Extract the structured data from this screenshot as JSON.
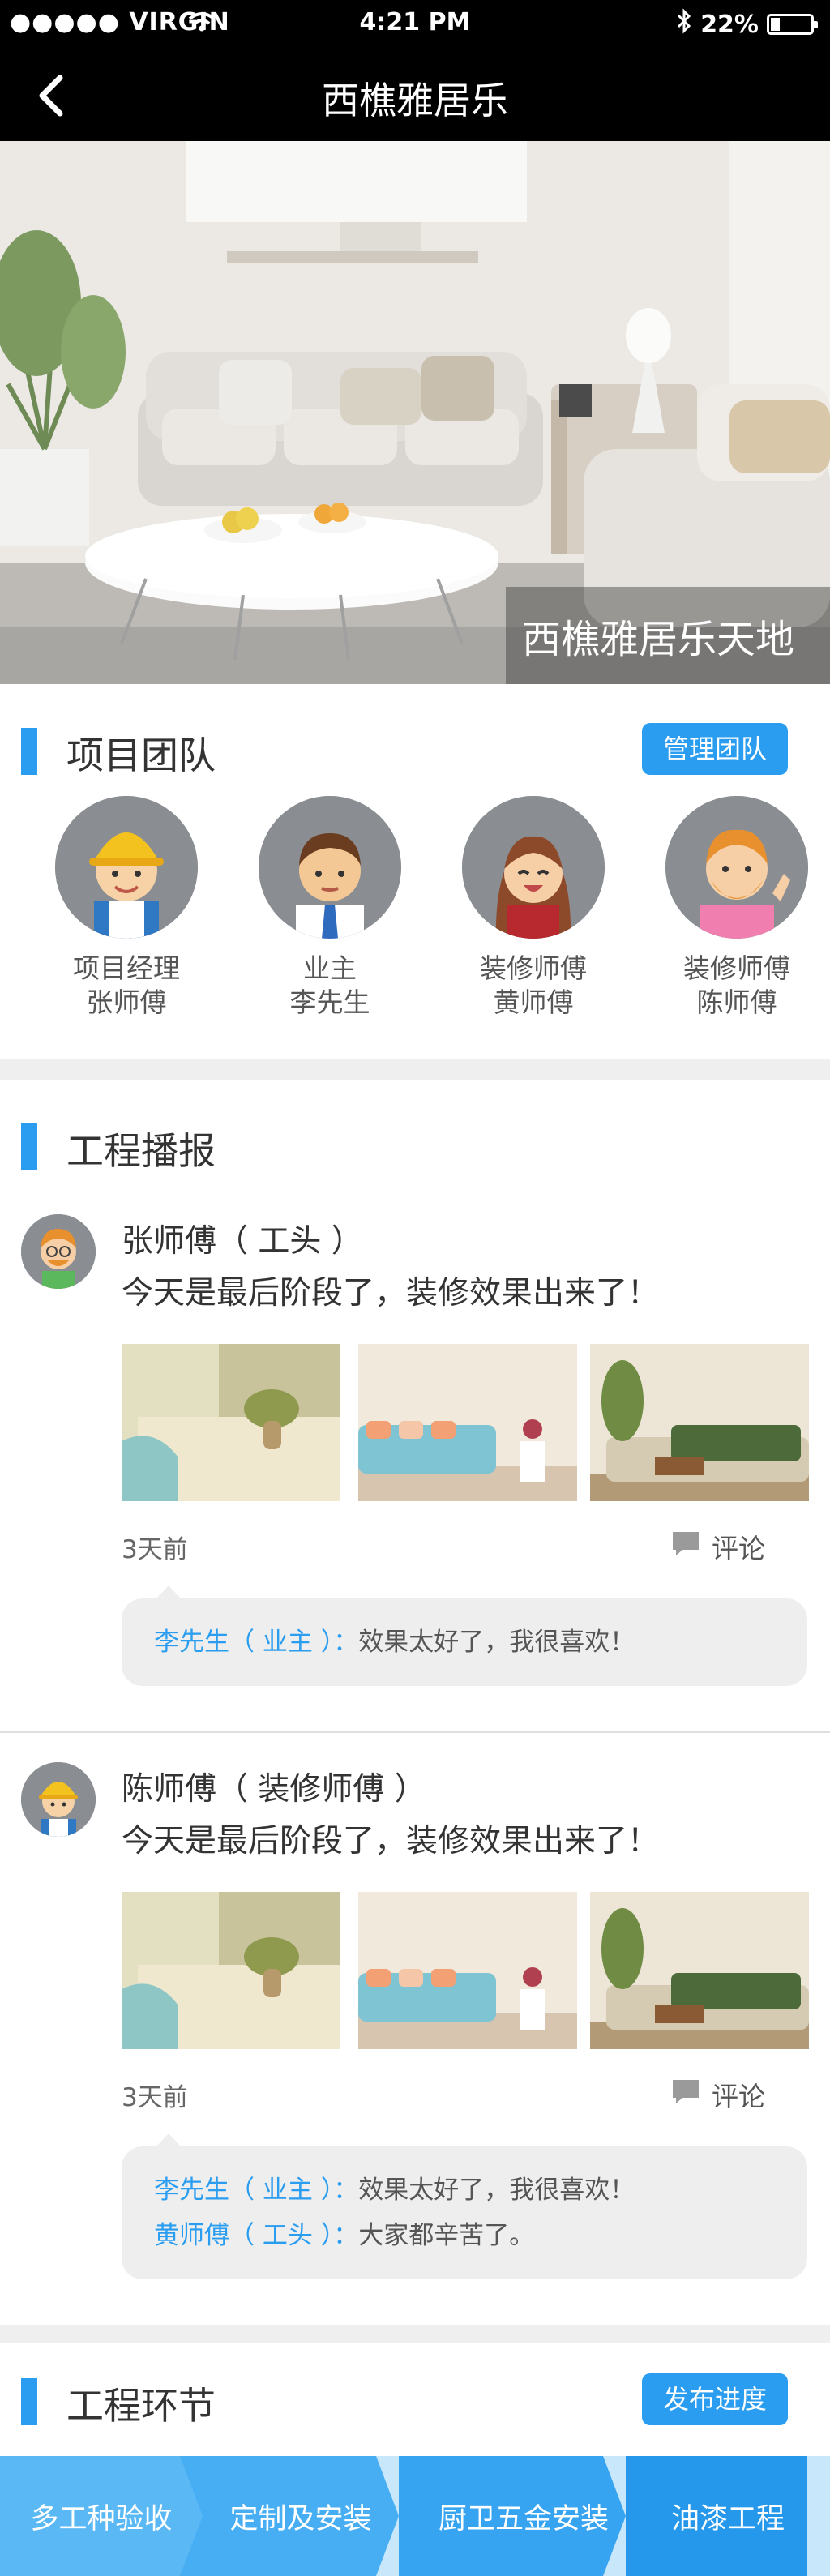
{
  "status_bar": {
    "carrier": "●●●●● VIRGIN",
    "time": "4:21 PM",
    "battery": "22%",
    "battery_level": 0.22
  },
  "nav": {
    "title": "西樵雅居乐"
  },
  "hero": {
    "caption": "西樵雅居乐天地"
  },
  "team": {
    "title": "项目团队",
    "manage_label": "管理团队",
    "members": [
      {
        "role": "项目经理",
        "name": "张师傅",
        "icon": "worker-avatar-icon"
      },
      {
        "role": "业主",
        "name": "李先生",
        "icon": "owner-avatar-icon"
      },
      {
        "role": "装修师傅",
        "name": "黄师傅",
        "icon": "woman-avatar-icon"
      },
      {
        "role": "装修师傅",
        "name": "陈师傅",
        "icon": "bearded-avatar-icon"
      }
    ]
  },
  "broadcast": {
    "title": "工程播报",
    "posts": [
      {
        "author": "张师傅（ 工头 ）",
        "content": "今天是最后阶段了，装修效果出来了！",
        "time": "3天前",
        "comment_label": "评论",
        "comments": [
          {
            "who": "李先生（ 业主 ）：",
            "text": "效果太好了，我很喜欢！"
          }
        ]
      },
      {
        "author": "陈师傅（ 装修师傅 ）",
        "content": "今天是最后阶段了，装修效果出来了！",
        "time": "3天前",
        "comment_label": "评论",
        "comments": [
          {
            "who": "李先生（ 业主 ）：",
            "text": "效果太好了，我很喜欢！"
          },
          {
            "who": "黄师傅（ 工头 ）：",
            "text": "大家都辛苦了。"
          }
        ]
      }
    ]
  },
  "process": {
    "title": "工程环节",
    "publish_label": "发布进度",
    "stages": [
      "多工种验收",
      "定制及安装",
      "厨卫五金安装",
      "油漆工程"
    ]
  },
  "colors": {
    "accent": "#2a9df0",
    "stage_colors": [
      "#5ab8f5",
      "#48aef3",
      "#36a4f1",
      "#2598ec"
    ]
  }
}
